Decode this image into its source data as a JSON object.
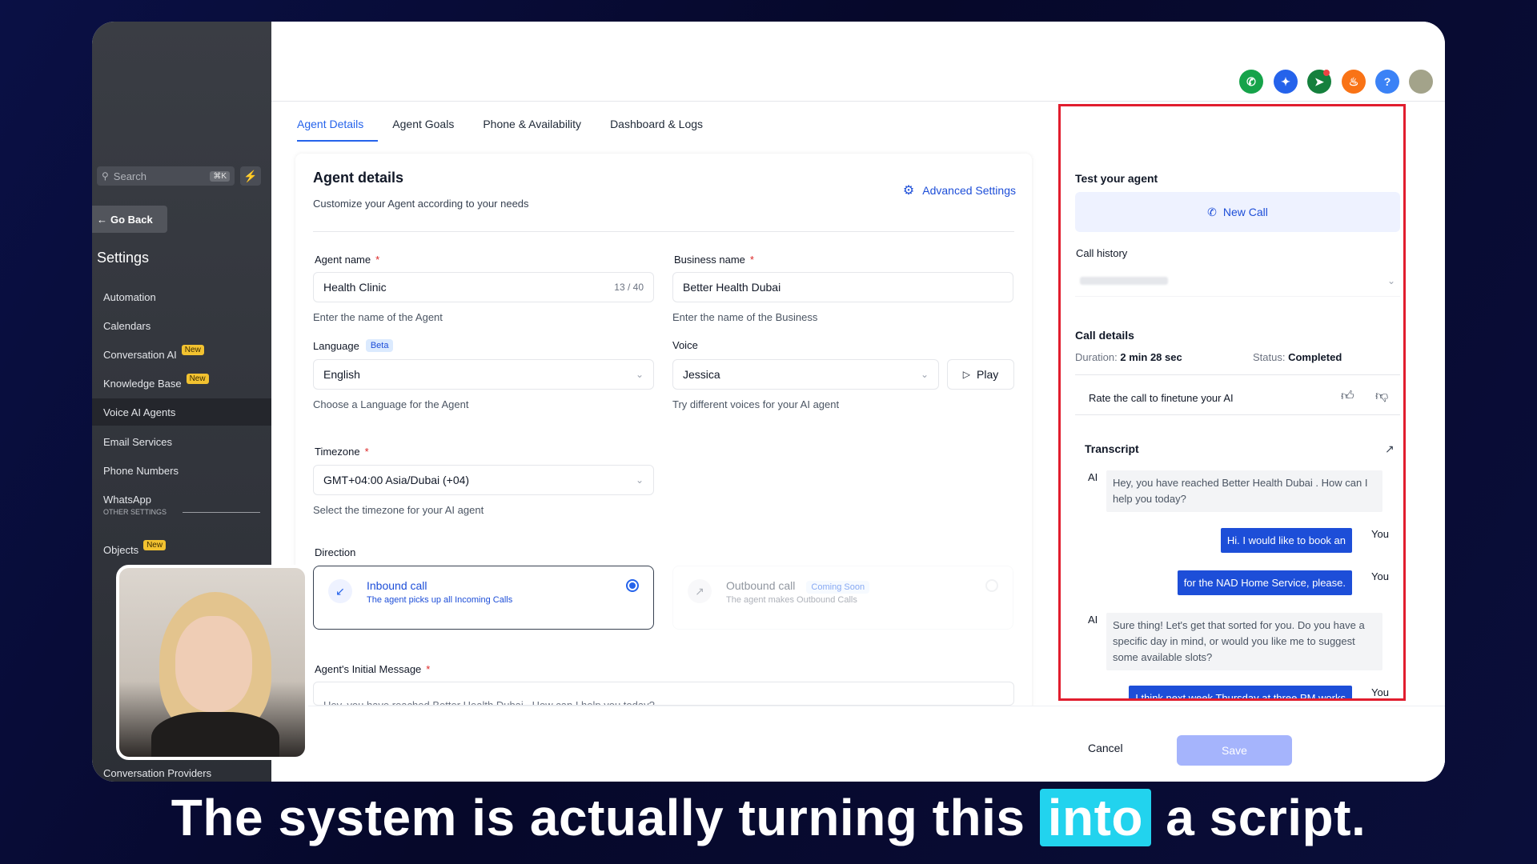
{
  "sidebar": {
    "search_placeholder": "Search",
    "search_shortcut": "⌘K",
    "go_back": "Go Back",
    "title": "Settings",
    "items": [
      {
        "label": "Automation",
        "badge": ""
      },
      {
        "label": "Calendars",
        "badge": ""
      },
      {
        "label": "Conversation AI",
        "badge": "New"
      },
      {
        "label": "Knowledge Base",
        "badge": "New"
      },
      {
        "label": "Voice AI Agents",
        "badge": ""
      },
      {
        "label": "Email Services",
        "badge": ""
      },
      {
        "label": "Phone Numbers",
        "badge": ""
      },
      {
        "label": "WhatsApp",
        "badge": ""
      }
    ],
    "other_settings_label": "OTHER SETTINGS",
    "other_items": [
      {
        "label": "Objects",
        "badge": "New"
      },
      {
        "label": "Conversation Providers",
        "badge": ""
      }
    ]
  },
  "topbar": {
    "icons": [
      "phone-icon",
      "sparkle-icon",
      "megaphone-icon",
      "bell-icon",
      "help-icon",
      "avatar"
    ]
  },
  "tabs": [
    "Agent Details",
    "Agent Goals",
    "Phone & Availability",
    "Dashboard & Logs"
  ],
  "agent_details": {
    "title": "Agent details",
    "subtitle": "Customize your Agent according to your needs",
    "advanced_settings": "Advanced Settings",
    "agent_name_label": "Agent name",
    "agent_name_value": "Health Clinic",
    "agent_name_counter": "13 / 40",
    "agent_name_hint": "Enter the name of the Agent",
    "business_name_label": "Business name",
    "business_name_value": "Better Health Dubai",
    "business_name_hint": "Enter the name of the Business",
    "language_label": "Language",
    "language_badge": "Beta",
    "language_value": "English",
    "language_hint": "Choose a Language for the Agent",
    "voice_label": "Voice",
    "voice_value": "Jessica",
    "play_label": "Play",
    "voice_hint": "Try different voices for your AI agent",
    "timezone_label": "Timezone",
    "timezone_value": "GMT+04:00 Asia/Dubai (+04)",
    "timezone_hint": "Select the timezone for your AI agent",
    "direction_label": "Direction",
    "inbound_title": "Inbound call",
    "inbound_desc": "The agent picks up all Incoming Calls",
    "outbound_title": "Outbound call",
    "outbound_badge": "Coming Soon",
    "outbound_desc": "The agent makes Outbound Calls",
    "initial_message_label": "Agent's Initial Message",
    "initial_message_preview": "Hey, you have reached Better Health Dubai . How can I help you today?"
  },
  "test_panel": {
    "title": "Test your agent",
    "new_call": "New Call",
    "call_history_label": "Call history",
    "call_details_label": "Call details",
    "duration_label": "Duration:",
    "duration_value": "2 min 28 sec",
    "status_label": "Status:",
    "status_value": "Completed",
    "rate_label": "Rate the call to finetune your AI",
    "transcript_label": "Transcript",
    "messages": [
      {
        "who": "AI",
        "text": "Hey, you have reached Better Health Dubai . How can I help you today?"
      },
      {
        "who": "You",
        "text": "Hi. I would like to book an"
      },
      {
        "who": "You",
        "text": "for the NAD Home Service, please."
      },
      {
        "who": "AI",
        "text": "Sure thing! Let's get that sorted for you. Do you have a specific day in mind, or would you like me to suggest some available slots?"
      },
      {
        "who": "You",
        "text": "I think next week Thursday at three PM works"
      }
    ]
  },
  "footer": {
    "cancel": "Cancel",
    "save": "Save"
  },
  "caption": {
    "before": "The system is actually turning this",
    "highlight": "into",
    "after": "a script."
  }
}
